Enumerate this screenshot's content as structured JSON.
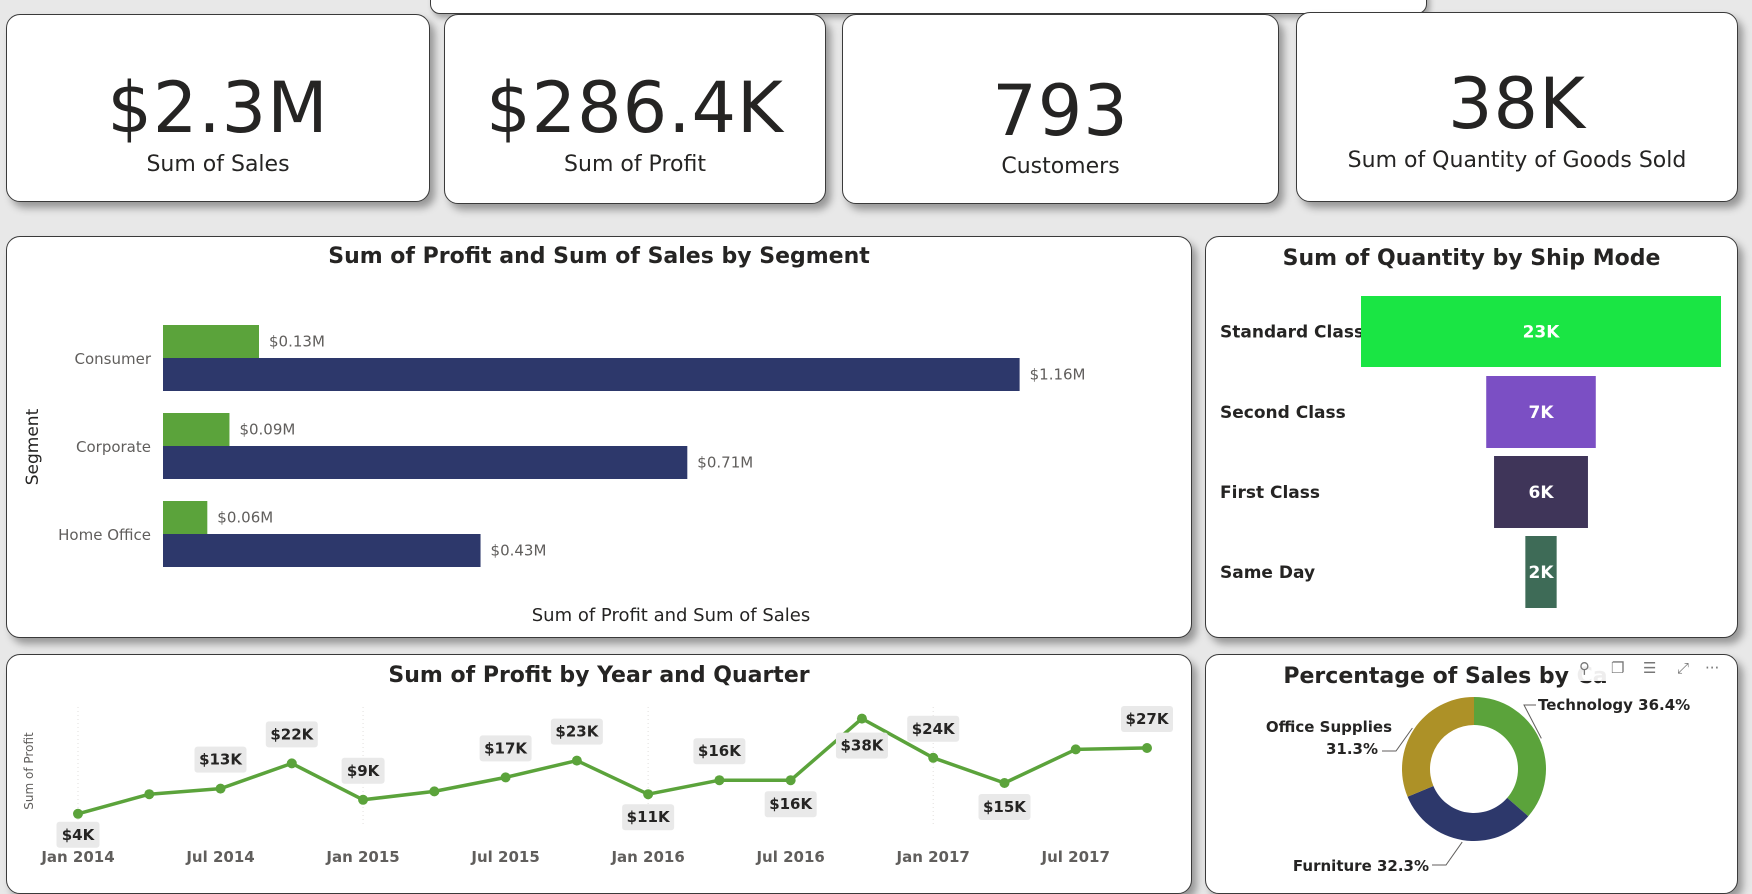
{
  "kpis": [
    {
      "value": "$2.3M",
      "label": "Sum of Sales"
    },
    {
      "value": "$286.4K",
      "label": "Sum of Profit"
    },
    {
      "value": "793",
      "label": "Customers"
    },
    {
      "value": "38K",
      "label": "Sum of Quantity of Goods Sold"
    }
  ],
  "colors": {
    "profit_green": "#5ba33b",
    "sales_navy": "#2d386b",
    "standard_class": "#1ae544",
    "second_class": "#7b4fc4",
    "first_class": "#3f3559",
    "same_day": "#3e6b57",
    "technology": "#5ba33b",
    "furniture": "#2d386b",
    "office_supplies": "#ad9127"
  },
  "visual_toolbar": {
    "icons": [
      "pin-icon",
      "copy-icon",
      "filter-icon",
      "focus-mode-icon",
      "more-options-icon"
    ],
    "glyphs": [
      "⚲",
      "❐",
      "☰",
      "⤢",
      "···"
    ]
  },
  "chart_data": [
    {
      "type": "bar",
      "orientation": "horizontal",
      "title": "Sum of Profit and Sum of Sales by Segment",
      "xlabel": "Sum of Profit and Sum of Sales",
      "ylabel": "Segment",
      "categories": [
        "Consumer",
        "Corporate",
        "Home Office"
      ],
      "xlim": [
        0,
        1.3
      ],
      "unit": "$M",
      "series": [
        {
          "name": "Sum of Profit",
          "values": [
            0.13,
            0.09,
            0.06
          ],
          "labels": [
            "$0.13M",
            "$0.09M",
            "$0.06M"
          ],
          "color": "#5ba33b"
        },
        {
          "name": "Sum of Sales",
          "values": [
            1.16,
            0.71,
            0.43
          ],
          "labels": [
            "$1.16M",
            "$0.71M",
            "$0.43M"
          ],
          "color": "#2d386b"
        }
      ]
    },
    {
      "type": "bar",
      "subtype": "funnel",
      "title": "Sum of Quantity by Ship Mode",
      "categories": [
        "Standard Class",
        "Second Class",
        "First Class",
        "Same Day"
      ],
      "values": [
        23,
        7,
        6,
        2
      ],
      "labels": [
        "23K",
        "7K",
        "6K",
        "2K"
      ],
      "colors": [
        "#1ae544",
        "#7b4fc4",
        "#3f3559",
        "#3e6b57"
      ]
    },
    {
      "type": "line",
      "title": "Sum of Profit by Year and Quarter",
      "ylabel": "Sum of Profit",
      "x": [
        "2014 Q1",
        "2014 Q2",
        "2014 Q3",
        "2014 Q4",
        "2015 Q1",
        "2015 Q2",
        "2015 Q3",
        "2015 Q4",
        "2016 Q1",
        "2016 Q2",
        "2016 Q3",
        "2016 Q4",
        "2017 Q1",
        "2017 Q2",
        "2017 Q3",
        "2017 Q4"
      ],
      "x_tick_labels": [
        "Jan 2014",
        "Jul 2014",
        "Jan 2015",
        "Jul 2015",
        "Jan 2016",
        "Jul 2016",
        "Jan 2017",
        "Jul 2017"
      ],
      "values": [
        4,
        11,
        13,
        22,
        9,
        12,
        17,
        23,
        11,
        16,
        16,
        38,
        24,
        15,
        27,
        27.5
      ],
      "data_labels": [
        "$4K",
        "",
        "$13K",
        "$22K",
        "$9K",
        "",
        "$17K",
        "$23K",
        "$11K",
        "$16K",
        "$16K",
        "$38K",
        "$24K",
        "$15K",
        "",
        "$27K"
      ],
      "ylim": [
        0,
        40
      ],
      "unit": "$K",
      "color": "#5ba33b"
    },
    {
      "type": "pie",
      "subtype": "donut",
      "title": "Percentage of Sales by Category",
      "title_visible": "Percentage of Sales by Ca",
      "categories": [
        "Technology",
        "Furniture",
        "Office Supplies"
      ],
      "values": [
        36.4,
        32.3,
        31.3
      ],
      "labels": [
        "Technology 36.4%",
        "Furniture 32.3%",
        "Office Supplies 31.3%"
      ],
      "colors": [
        "#5ba33b",
        "#2d386b",
        "#ad9127"
      ]
    }
  ]
}
